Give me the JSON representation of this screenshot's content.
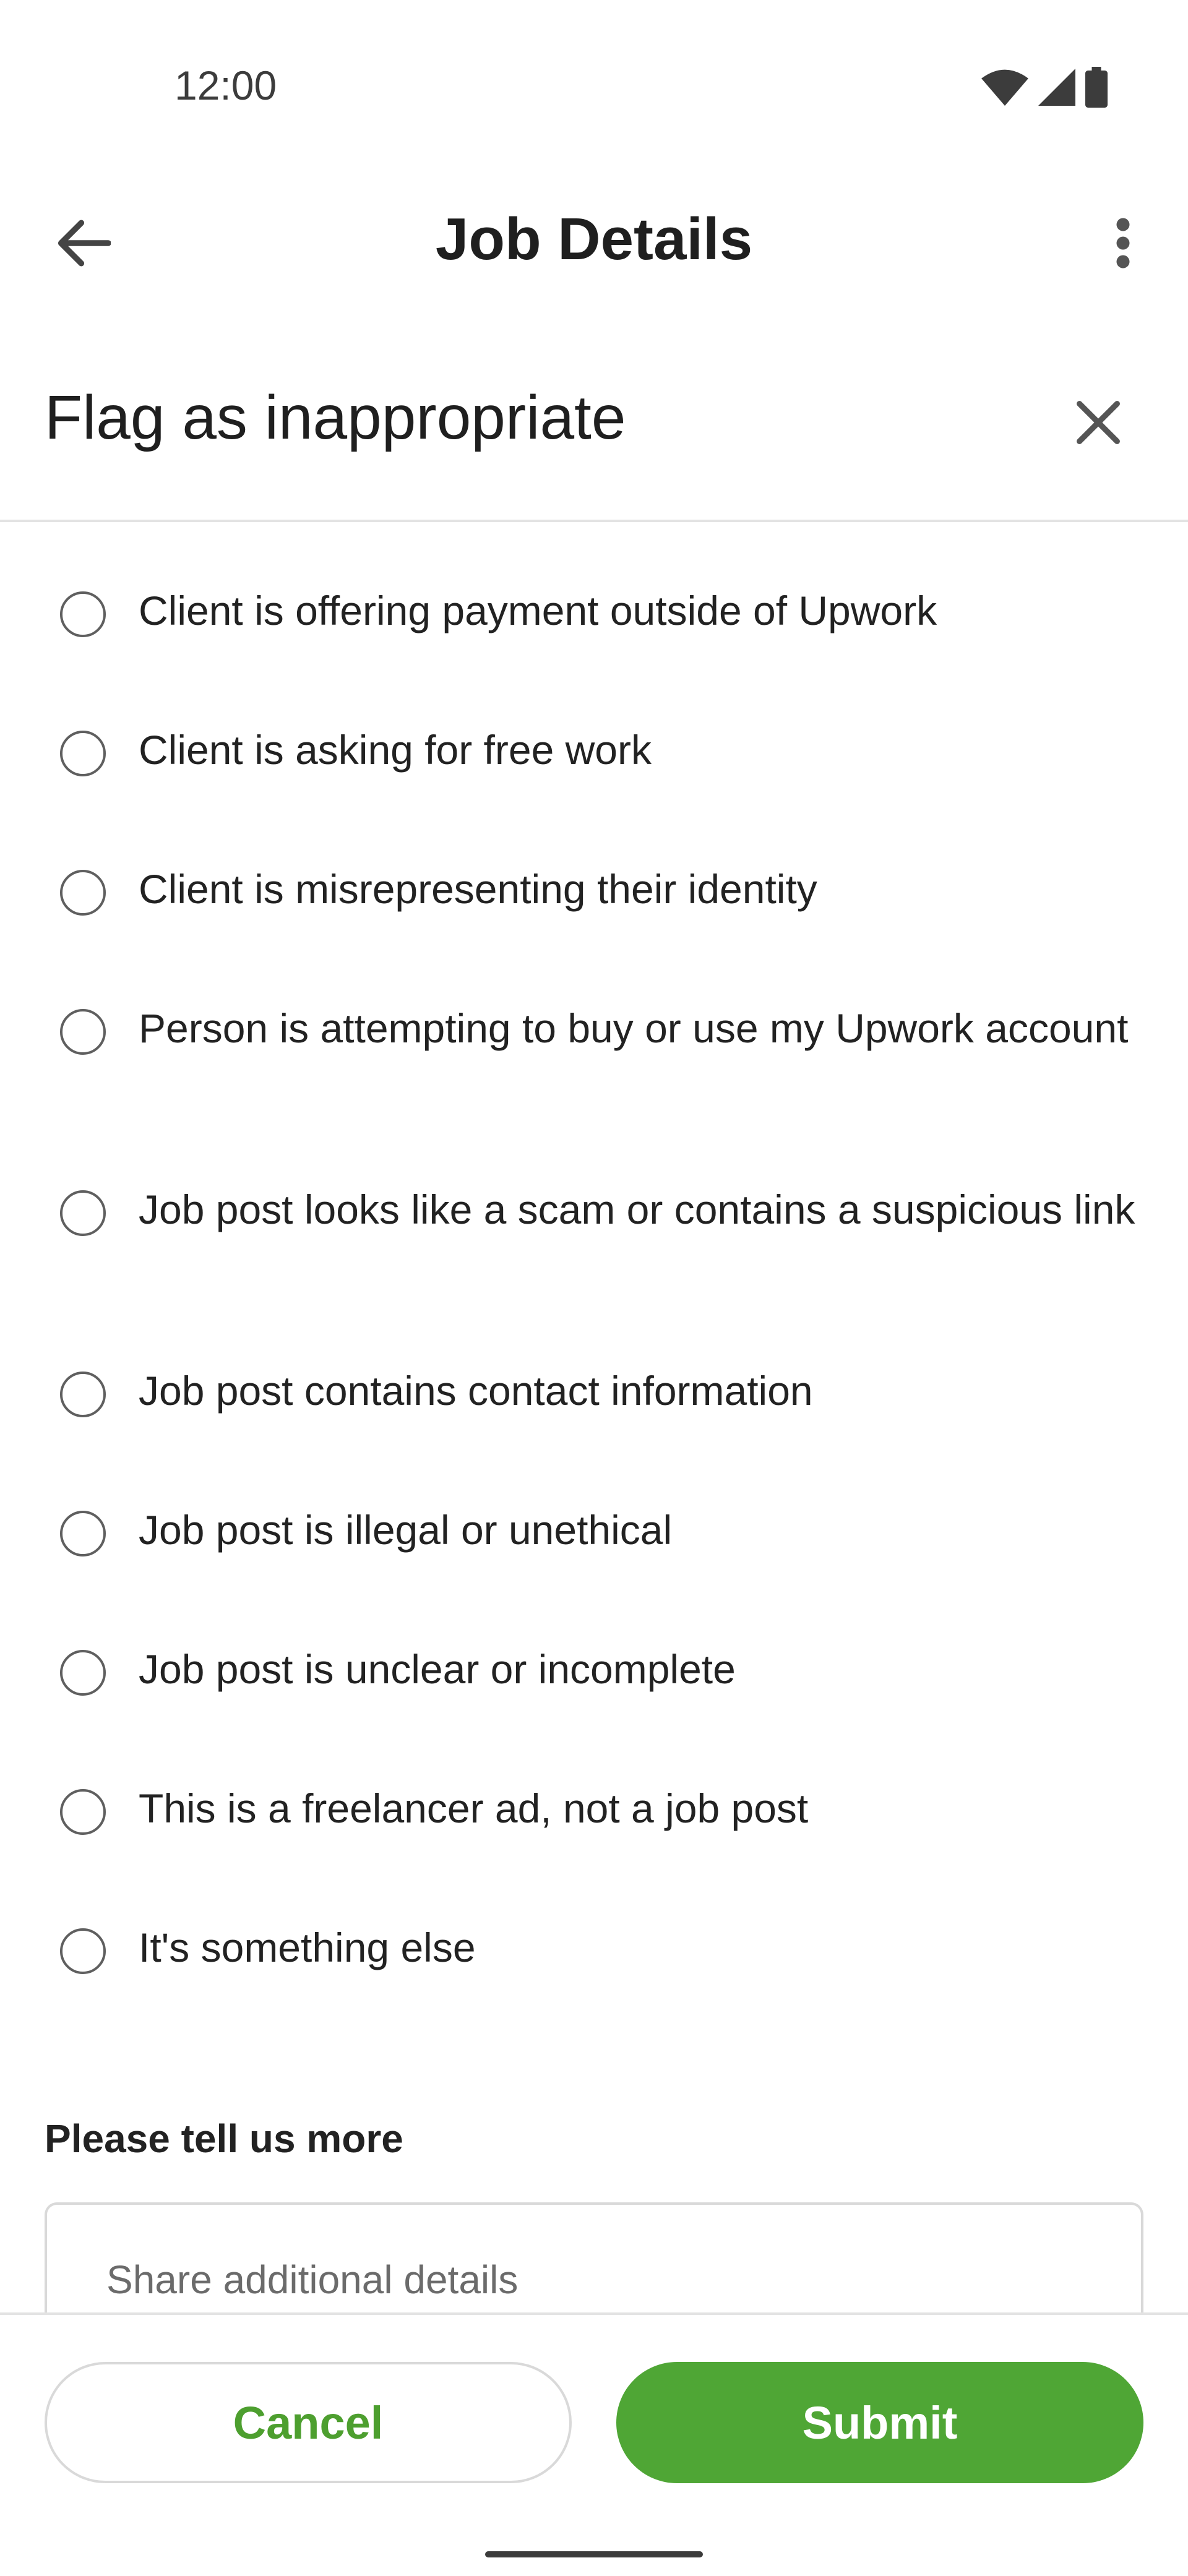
{
  "status_bar": {
    "time": "12:00",
    "icons": [
      "wifi-icon",
      "cellular-signal-icon",
      "battery-icon"
    ]
  },
  "app_bar": {
    "title": "Job Details",
    "back_icon": "arrow-left-icon",
    "menu_icon": "more-vertical-icon"
  },
  "sheet": {
    "title": "Flag as inappropriate",
    "close_icon": "close-icon"
  },
  "options": [
    {
      "label": "Client is offering payment outside of Upwork",
      "selected": false
    },
    {
      "label": "Client is asking for free work",
      "selected": false
    },
    {
      "label": "Client is misrepresenting their identity",
      "selected": false
    },
    {
      "label": "Person is attempting to buy or use my Upwork account",
      "selected": false
    },
    {
      "label": "Job post looks like a scam or contains a suspicious link",
      "selected": false
    },
    {
      "label": "Job post contains contact information",
      "selected": false
    },
    {
      "label": "Job post is illegal or unethical",
      "selected": false
    },
    {
      "label": "Job post is unclear or incomplete",
      "selected": false
    },
    {
      "label": "This is a freelancer ad, not a job post",
      "selected": false
    },
    {
      "label": "It's something else",
      "selected": false
    }
  ],
  "details": {
    "label": "Please tell us more",
    "placeholder": "Share additional details"
  },
  "footer": {
    "cancel_label": "Cancel",
    "submit_label": "Submit"
  },
  "colors": {
    "accent": "#4fa635",
    "accent_text": "#4d9f2f"
  }
}
